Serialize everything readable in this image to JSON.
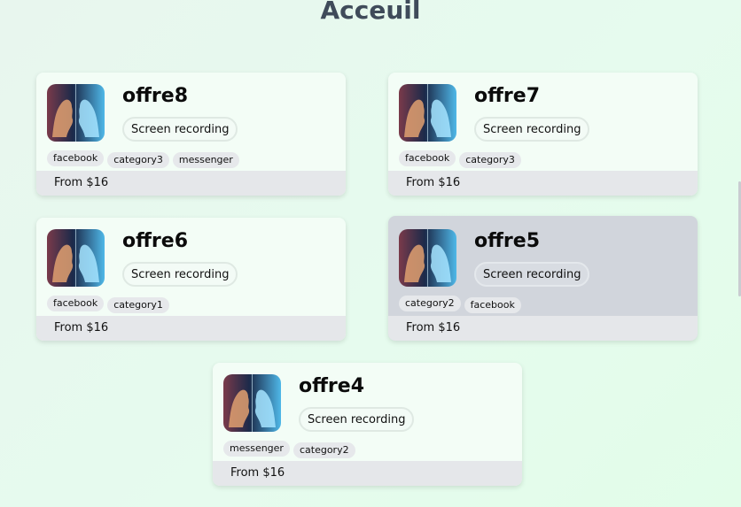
{
  "page": {
    "title": "Acceuil"
  },
  "colors": {
    "card_bg": "#f3fdf6",
    "card_highlight_bg": "#d1d5dc",
    "footer_bg": "#e5e7ea",
    "title": "#3f4b5a"
  },
  "offers": [
    {
      "title": "offre8",
      "button_label": "Screen recording",
      "tags": [
        "facebook",
        "category3",
        "messenger"
      ],
      "price": "From $16",
      "image_icon": "faces-artwork-icon"
    },
    {
      "title": "offre7",
      "button_label": "Screen recording",
      "tags": [
        "facebook",
        "category3"
      ],
      "price": "From $16",
      "image_icon": "faces-artwork-icon"
    },
    {
      "title": "offre6",
      "button_label": "Screen recording",
      "tags": [
        "facebook",
        "category1"
      ],
      "price": "From $16",
      "image_icon": "faces-artwork-icon"
    },
    {
      "title": "offre5",
      "button_label": "Screen recording",
      "tags": [
        "category2",
        "facebook"
      ],
      "price": "From $16",
      "image_icon": "faces-artwork-icon",
      "hovered": true
    },
    {
      "title": "offre4",
      "button_label": "Screen recording",
      "tags": [
        "messenger",
        "category2"
      ],
      "price": "From $16",
      "image_icon": "faces-artwork-icon"
    }
  ]
}
